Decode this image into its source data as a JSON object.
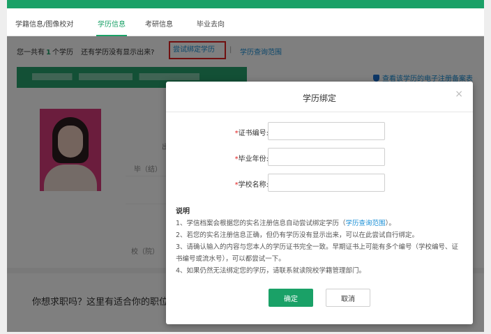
{
  "nav": {
    "tabs": [
      {
        "label": "学籍信息/图像校对"
      },
      {
        "label": "学历信息"
      },
      {
        "label": "考研信息"
      },
      {
        "label": "毕业去向"
      }
    ]
  },
  "summary": {
    "prefix": "您一共有",
    "count": "1",
    "suffix": "个学历",
    "question": "还有学历没有显示出来?",
    "bind_link": "尝试绑定学历",
    "separator": "|",
    "range_link": "学历查询范围"
  },
  "registration_link": "查看该学历的电子注册备案表",
  "background_fields": {
    "out": "出",
    "graduate": "毕（结）",
    "school": "校（院）"
  },
  "job_banner": "你想求职吗？这里有适合你的职位",
  "modal": {
    "title": "学历绑定",
    "close": "×",
    "fields": [
      {
        "label": "证书编号:",
        "value": ""
      },
      {
        "label": "毕业年份:",
        "value": ""
      },
      {
        "label": "学校名称:",
        "value": ""
      }
    ],
    "required_mark": "*",
    "desc_title": "说明",
    "desc": [
      {
        "pre": "1、学信档案会根据您的实名注册信息自动尝试绑定学历（",
        "link": "学历查询范围",
        "post": "）。"
      },
      {
        "pre": "2、若您的实名注册信息正确，但仍有学历没有显示出来，可以在此尝试自行绑定。",
        "link": "",
        "post": ""
      },
      {
        "pre": "3、请确认输入的内容与您本人的学历证书完全一致。早期证书上可能有多个编号（学校编号、证书编号或流水号），可以都尝试一下。",
        "link": "",
        "post": ""
      },
      {
        "pre": "4、如果仍然无法绑定您的学历，请联系就读院校学籍管理部门。",
        "link": "",
        "post": ""
      }
    ],
    "ok_label": "确定",
    "cancel_label": "取消"
  },
  "colors": {
    "brand": "#1aa167",
    "link": "#1a8fd6",
    "highlight": "#e02020"
  }
}
